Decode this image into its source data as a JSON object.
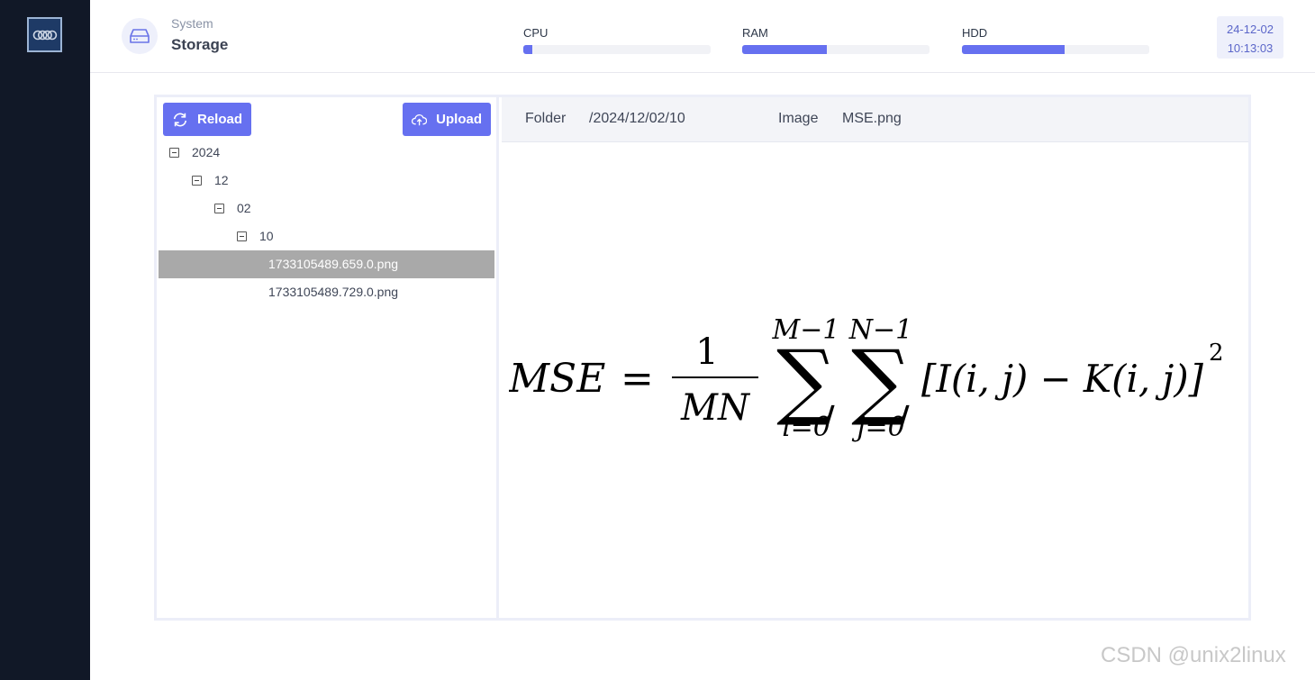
{
  "header": {
    "section": "System",
    "title": "Storage"
  },
  "meters": [
    {
      "label": "CPU",
      "fill": 0.05
    },
    {
      "label": "RAM",
      "fill": 0.45
    },
    {
      "label": "HDD",
      "fill": 0.55
    }
  ],
  "datetime": {
    "date": "24-12-02",
    "time": "10:13:03"
  },
  "toolbar": {
    "reload_label": "Reload",
    "upload_label": "Upload"
  },
  "tree": {
    "year": "2024",
    "month": "12",
    "day": "02",
    "hour": "10",
    "files": [
      "1733105489.659.0.png",
      "1733105489.729.0.png"
    ],
    "selected_index": 0
  },
  "viewer": {
    "folder_label": "Folder",
    "folder_value": "/2024/12/02/10",
    "image_label": "Image",
    "image_value": "MSE.png"
  },
  "formula": {
    "lhs": "MSE",
    "numerator": "1",
    "denominator": "MN",
    "sum1_upper": "M−1",
    "sum1_lower": "i=0",
    "sum2_upper": "N−1",
    "sum2_lower": "j=0",
    "body": "[I(i, j) − K(i, j)]",
    "exponent": "2"
  },
  "watermark": "CSDN @unix2linux",
  "colors": {
    "sidebar": "#111827",
    "accent": "#6670f0",
    "selected_row": "#a9a9a9"
  }
}
